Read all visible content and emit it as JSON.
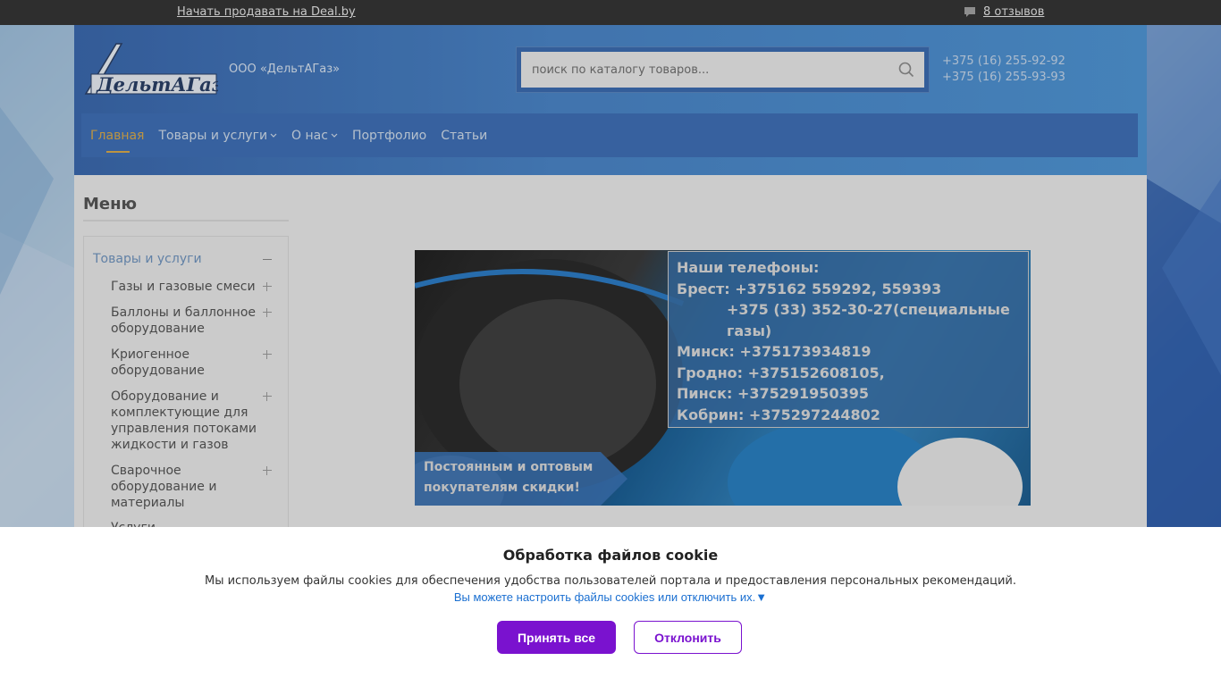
{
  "topbar": {
    "sell_link": "Начать продавать на Deal.by",
    "reviews_label": "8 отзывов",
    "reviews_icon": "chat-icon"
  },
  "header": {
    "logo_text": "ДельтАГаз",
    "company_name": "ООО «ДельтАГаз»",
    "search_placeholder": "поиск по каталогу товаров...",
    "phones": [
      "+375 (16) 255-92-92",
      "+375 (16) 255-93-93"
    ]
  },
  "nav": {
    "items": [
      {
        "label": "Главная",
        "active": true
      },
      {
        "label": "Товары и услуги",
        "dropdown": true
      },
      {
        "label": "О нас",
        "dropdown": true
      },
      {
        "label": "Портфолио"
      },
      {
        "label": "Статьи"
      }
    ]
  },
  "sidebar": {
    "title": "Меню",
    "head": "Товары и услуги",
    "items": [
      {
        "label": "Газы и газовые смеси"
      },
      {
        "label": "Баллоны и баллонное оборудование"
      },
      {
        "label": "Криогенное оборудование"
      },
      {
        "label": "Оборудование и комплектующие для управления потоками жидкости и газов"
      },
      {
        "label": "Сварочное оборудование и материалы"
      },
      {
        "label": "Услуги"
      }
    ]
  },
  "banner": {
    "lines": [
      "Наши телефоны:",
      "Брест: +375162 559292, 559393",
      "+375 (33) 352-30-27(специальные газы)",
      "Минск: +375173934819",
      "Гродно: +375152608105,",
      "Пинск: +375291950395",
      "Кобрин: +375297244802"
    ],
    "discount_line1": "Постоянным и оптовым",
    "discount_line2": "покупателям скидки!"
  },
  "cookie": {
    "title": "Обработка файлов cookie",
    "text": "Мы используем файлы cookies для обеспечения удобства пользователей портала и предоставления персональных рекомендаций.",
    "link": "Вы можете настроить файлы cookies или отключить их.▼",
    "accept_label": "Принять все",
    "decline_label": "Отклонить"
  },
  "colors": {
    "accent": "#7a12cf",
    "nav_active": "#d8a94a",
    "topbar": "#2e2e2e"
  }
}
